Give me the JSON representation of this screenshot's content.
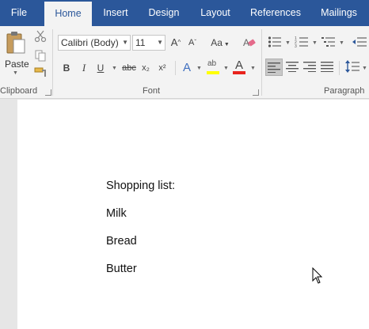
{
  "tabs": [
    {
      "label": "File"
    },
    {
      "label": "Home"
    },
    {
      "label": "Insert"
    },
    {
      "label": "Design"
    },
    {
      "label": "Layout"
    },
    {
      "label": "References"
    },
    {
      "label": "Mailings"
    }
  ],
  "clipboard": {
    "paste_label": "Paste",
    "group_label": "Clipboard"
  },
  "font": {
    "font_name": "Calibri (Body)",
    "font_size": "11",
    "change_case": "Aa",
    "bold": "B",
    "italic": "I",
    "underline": "U",
    "strikethrough": "abc",
    "subscript": "x₂",
    "superscript": "x²",
    "text_effects": "A",
    "highlight": "ab",
    "font_color": "A",
    "group_label": "Font"
  },
  "paragraph": {
    "group_label": "Paragraph"
  },
  "document": {
    "lines": [
      "Shopping list:",
      "Milk",
      "Bread",
      "Butter"
    ]
  },
  "colors": {
    "brand_blue": "#2b579a",
    "highlight_yellow": "#ffff00",
    "font_red": "#e8231d"
  }
}
